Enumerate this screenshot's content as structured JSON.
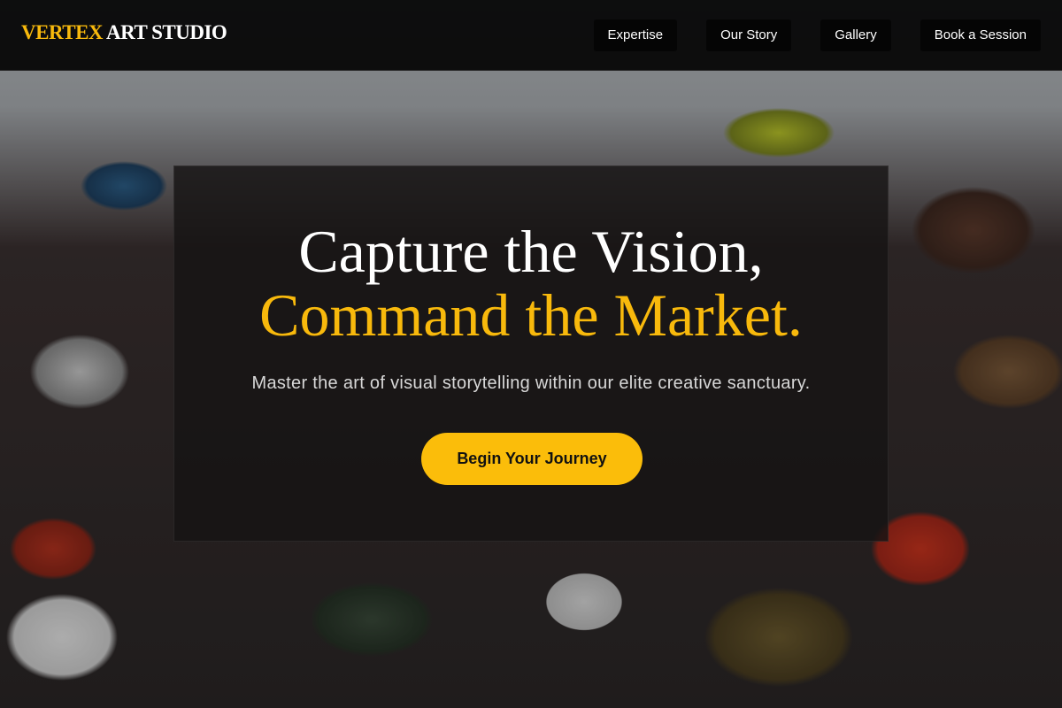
{
  "brand": {
    "accent": "VERTEX",
    "main": "ART STUDIO"
  },
  "nav": {
    "items": [
      {
        "label": "Expertise"
      },
      {
        "label": "Our Story"
      },
      {
        "label": "Gallery"
      },
      {
        "label": "Book a Session"
      }
    ]
  },
  "hero": {
    "title_line1": "Capture the Vision,",
    "title_line2": "Command the Market.",
    "subtitle": "Master the art of visual storytelling within our elite creative sanctuary.",
    "cta_label": "Begin Your Journey"
  },
  "colors": {
    "accent": "#f8b90c",
    "navbar_bg": "#080808",
    "cta_bg": "#fbbd0a"
  }
}
